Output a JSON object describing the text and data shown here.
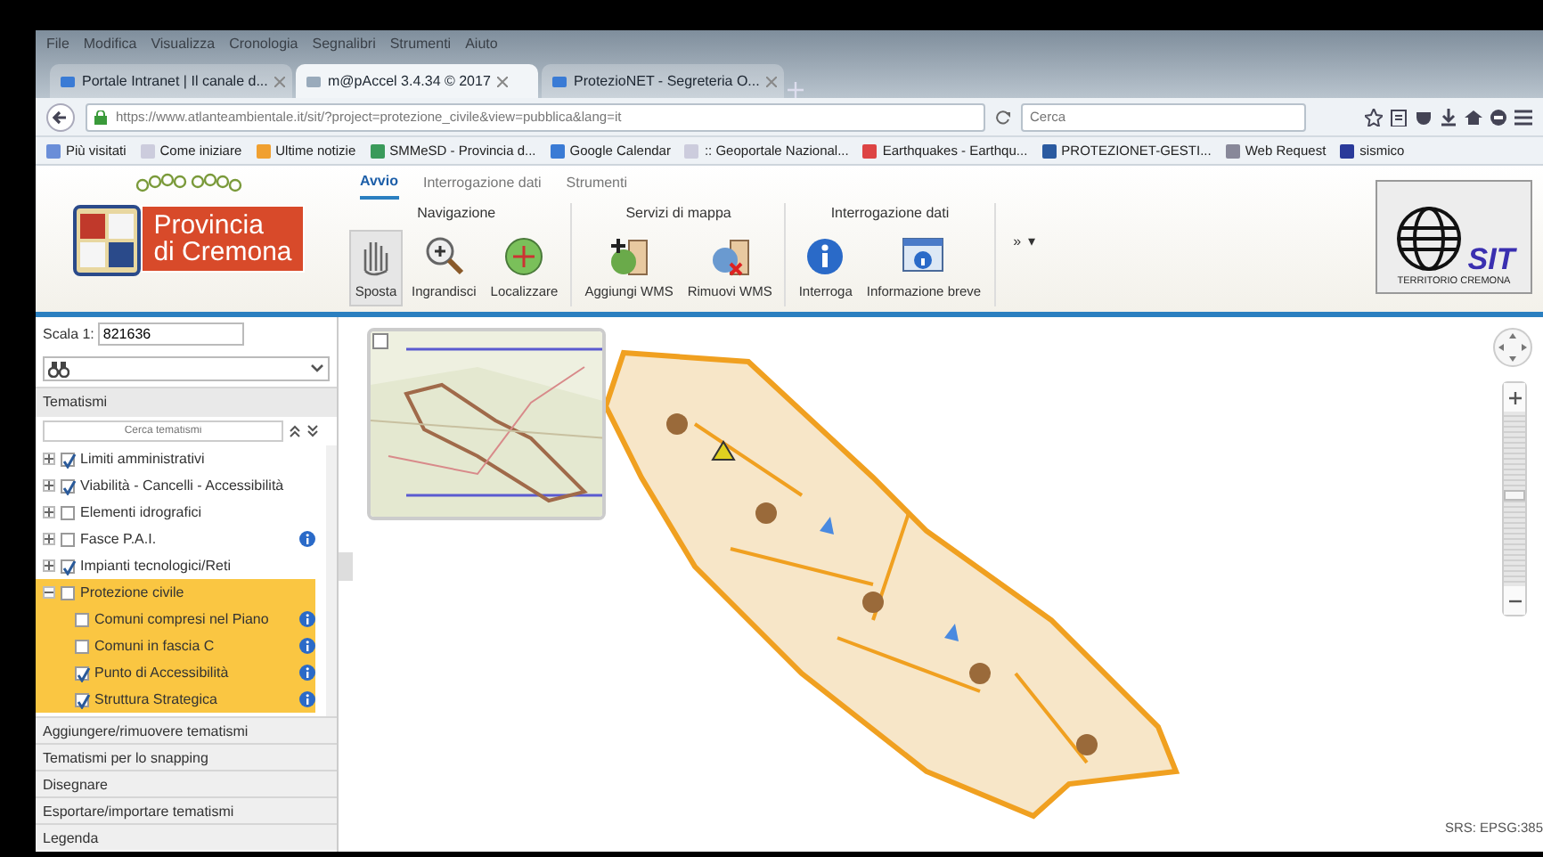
{
  "browser": {
    "menu": [
      "File",
      "Modifica",
      "Visualizza",
      "Cronologia",
      "Segnalibri",
      "Strumenti",
      "Aiuto"
    ],
    "tabs": [
      {
        "label": "Portale Intranet | Il canale d...",
        "selected": false
      },
      {
        "label": "m@pAccel 3.4.34 © 2017",
        "selected": true
      },
      {
        "label": "ProtezioNET - Segreteria O...",
        "selected": false
      }
    ],
    "url": "https://www.atlanteambientale.it/sit/?project=protezione_civile&view=pubblica&lang=it",
    "search": {
      "placeholder": "Cerca"
    },
    "bookmarks": [
      "Più visitati",
      "Come iniziare",
      "Ultime notizie",
      "SMMeSD - Provincia d...",
      "Google Calendar",
      ":: Geoportale Nazional...",
      "Earthquakes - Earthqu...",
      "PROTEZIONET-GESTI...",
      "Web Request",
      "sismico"
    ]
  },
  "app": {
    "logo": {
      "line_1": "Provincia",
      "line_2": "di Cremona"
    },
    "ribbon_tabs": [
      {
        "label": "Avvio",
        "selected": true
      },
      {
        "label": "Interrogazione dati",
        "selected": false
      },
      {
        "label": "Strumenti",
        "selected": false
      }
    ],
    "groups": [
      {
        "title": "Navigazione",
        "buttons": [
          {
            "label": "Sposta",
            "selected": true
          },
          {
            "label": "Ingrandisci",
            "selected": false
          },
          {
            "label": "Localizzare",
            "selected": false
          }
        ]
      },
      {
        "title": "Servizi di mappa",
        "buttons": [
          {
            "label": "Aggiungi WMS",
            "selected": false
          },
          {
            "label": "Rimuovi WMS",
            "selected": false
          }
        ]
      },
      {
        "title": "Interrogazione dati",
        "buttons": [
          {
            "label": "Interroga",
            "selected": false
          },
          {
            "label": "Informazione breve",
            "selected": false
          }
        ]
      }
    ],
    "more": "»",
    "more_caret": "▾",
    "sit_logo": {
      "caption": "TERRITORIO CREMONA",
      "mark": "SIT"
    }
  },
  "sidebar": {
    "scale_label": "Scala 1:",
    "scale_value": "821636",
    "tematismi": {
      "title": "Tematismi",
      "filter_placeholder": "Cerca tematismi",
      "layers": [
        {
          "label": "Limiti amministrativi",
          "checked": true,
          "expanded": false,
          "info": false,
          "selected": false
        },
        {
          "label": "Viabilità - Cancelli - Accessibilità",
          "checked": true,
          "expanded": false,
          "info": false,
          "selected": false
        },
        {
          "label": "Elementi idrografici",
          "checked": false,
          "expanded": false,
          "info": false,
          "selected": false
        },
        {
          "label": "Fasce P.A.I.",
          "checked": false,
          "expanded": false,
          "info": true,
          "selected": false
        },
        {
          "label": "Impianti tecnologici/Reti",
          "checked": true,
          "expanded": false,
          "info": false,
          "selected": false
        },
        {
          "label": "Protezione civile",
          "checked": false,
          "expanded": true,
          "info": false,
          "selected": true,
          "children": [
            {
              "label": "Comuni compresi nel Piano",
              "checked": false,
              "info": true
            },
            {
              "label": "Comuni in fascia C",
              "checked": false,
              "info": true
            },
            {
              "label": "Punto di Accessibilità",
              "checked": true,
              "info": true
            },
            {
              "label": "Struttura Strategica",
              "checked": true,
              "info": true
            }
          ]
        }
      ]
    },
    "sections": [
      "Aggiungere/rimuovere tematismi",
      "Tematismi per lo snapping",
      "Disegnare",
      "Esportare/importare tematismi",
      "Legenda"
    ]
  },
  "map": {
    "zoom": {
      "level": 0.52
    },
    "srs": "SRS: EPSG:385"
  }
}
